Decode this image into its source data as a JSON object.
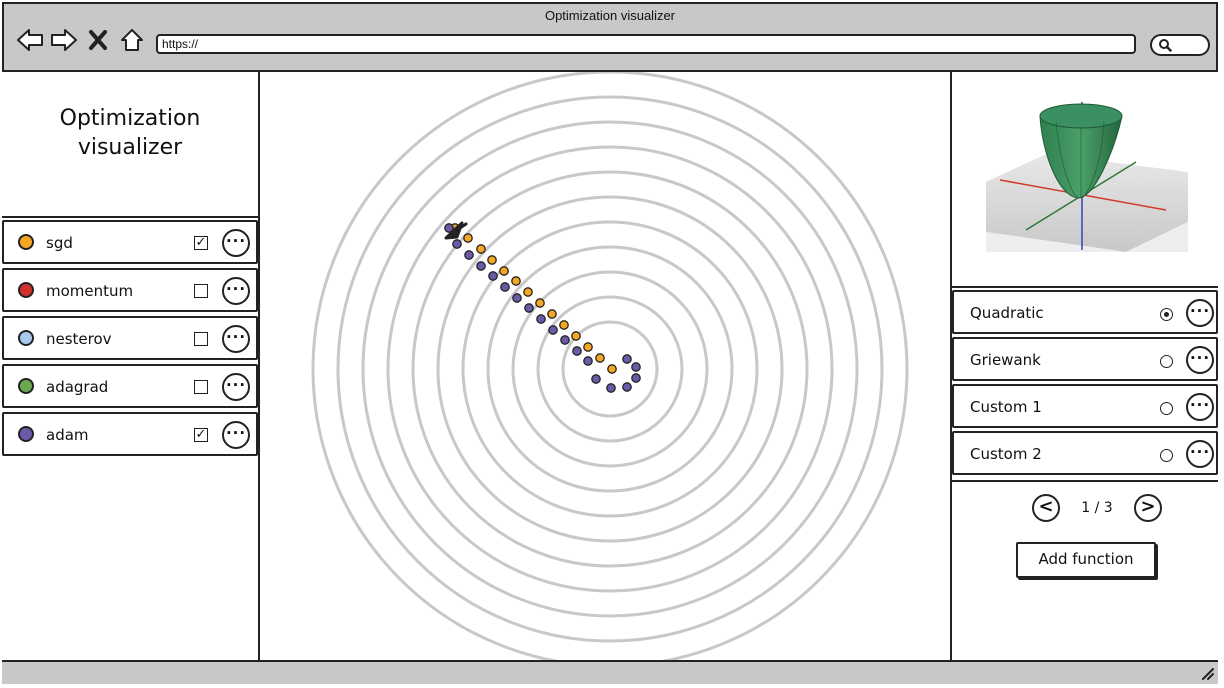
{
  "window": {
    "title": "Optimization visualizer",
    "url": "https://"
  },
  "sidebar": {
    "title_line1": "Optimization",
    "title_line2": "visualizer",
    "optimizers": [
      {
        "name": "sgd",
        "color": "#f5a623",
        "checked": true
      },
      {
        "name": "momentum",
        "color": "#d0312d",
        "checked": false
      },
      {
        "name": "nesterov",
        "color": "#a8c8f0",
        "checked": false
      },
      {
        "name": "adagrad",
        "color": "#6aa84f",
        "checked": false
      },
      {
        "name": "adam",
        "color": "#6a5aa8",
        "checked": true
      }
    ],
    "checked_glyph": "☑",
    "unchecked_glyph": ""
  },
  "functions": {
    "items": [
      {
        "name": "Quadratic",
        "selected": true
      },
      {
        "name": "Griewank",
        "selected": false
      },
      {
        "name": "Custom 1",
        "selected": false
      },
      {
        "name": "Custom 2",
        "selected": false
      }
    ],
    "pager": {
      "prev": "<",
      "text": "1 / 3",
      "next": ">"
    },
    "add_label": "Add function"
  },
  "more_glyph": "···",
  "contour": {
    "rings": 11,
    "color": "#c8c8c8"
  },
  "trajectories": {
    "sgd": {
      "color": "#f5a623",
      "points": [
        [
          -155,
          -141
        ],
        [
          -142,
          -131
        ],
        [
          -129,
          -120
        ],
        [
          -118,
          -109
        ],
        [
          -106,
          -98
        ],
        [
          -94,
          -88
        ],
        [
          -82,
          -77
        ],
        [
          -70,
          -66
        ],
        [
          -58,
          -55
        ],
        [
          -46,
          -44
        ],
        [
          -34,
          -33
        ],
        [
          -22,
          -22
        ],
        [
          -10,
          -11
        ],
        [
          2,
          0
        ]
      ]
    },
    "adam": {
      "color": "#6a5aa8",
      "points": [
        [
          -161,
          -141
        ],
        [
          -153,
          -125
        ],
        [
          -141,
          -114
        ],
        [
          -129,
          -103
        ],
        [
          -117,
          -93
        ],
        [
          -105,
          -82
        ],
        [
          -93,
          -71
        ],
        [
          -81,
          -61
        ],
        [
          -69,
          -50
        ],
        [
          -57,
          -39
        ],
        [
          -45,
          -29
        ],
        [
          -33,
          -18
        ],
        [
          -22,
          -8
        ],
        [
          -14,
          10
        ],
        [
          1,
          19
        ],
        [
          17,
          18
        ],
        [
          26,
          9
        ],
        [
          26,
          -2
        ],
        [
          17,
          -10
        ]
      ]
    }
  }
}
